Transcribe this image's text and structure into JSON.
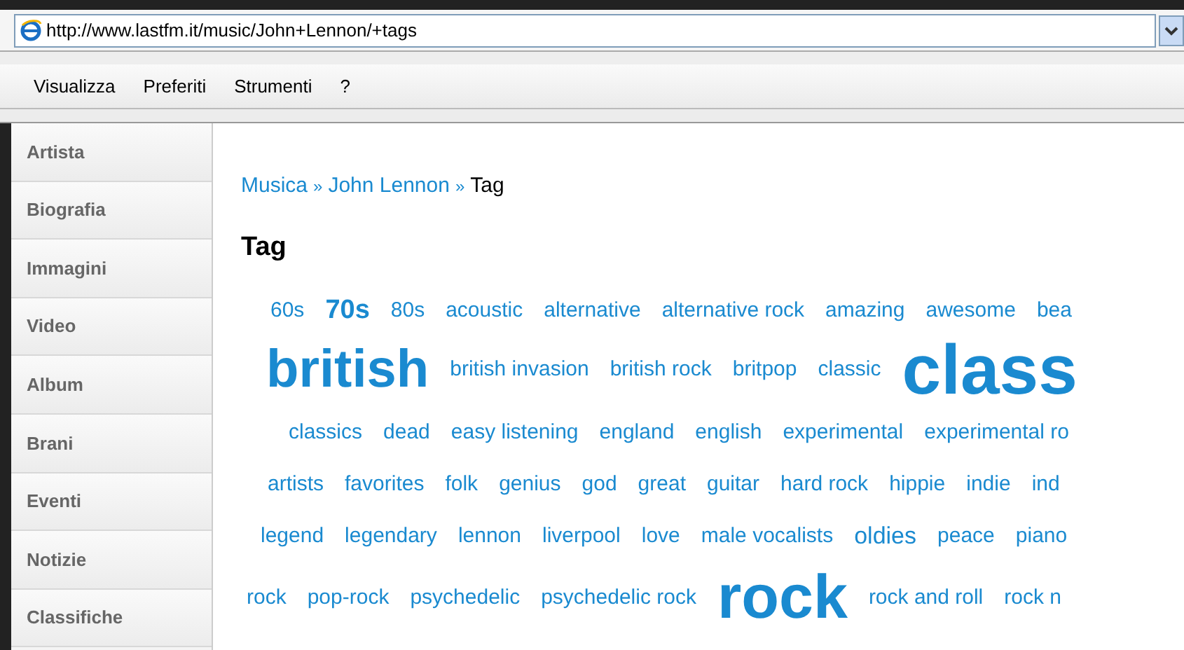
{
  "address_bar": {
    "url": "http://www.lastfm.it/music/John+Lennon/+tags"
  },
  "menu_bar": [
    "Visualizza",
    "Preferiti",
    "Strumenti",
    "?"
  ],
  "sidebar": {
    "items": [
      "Artista",
      "Biografia",
      "Immagini",
      "Video",
      "Album",
      "Brani",
      "Eventi",
      "Notizie",
      "Classifiche"
    ]
  },
  "breadcrumb": {
    "links": [
      "Musica",
      "John Lennon"
    ],
    "current": "Tag",
    "separator": "»"
  },
  "heading": "Tag",
  "tag_cloud": [
    [
      {
        "text": "60s",
        "kind": "normal"
      },
      {
        "text": "70s",
        "kind": "medium"
      },
      {
        "text": "80s",
        "kind": "normal"
      },
      {
        "text": "acoustic",
        "kind": "normal"
      },
      {
        "text": "alternative",
        "kind": "normal"
      },
      {
        "text": "alternative rock",
        "kind": "normal"
      },
      {
        "text": "amazing",
        "kind": "normal"
      },
      {
        "text": "awesome",
        "kind": "normal"
      },
      {
        "text": "bea",
        "kind": "normal"
      }
    ],
    [
      {
        "text": "british",
        "kind": "large"
      },
      {
        "text": "british invasion",
        "kind": "normal"
      },
      {
        "text": "british rock",
        "kind": "normal"
      },
      {
        "text": "britpop",
        "kind": "normal"
      },
      {
        "text": "classic",
        "kind": "normal"
      },
      {
        "text": "class",
        "kind": "huge"
      }
    ],
    [
      {
        "text": "classics",
        "kind": "normal"
      },
      {
        "text": "dead",
        "kind": "normal"
      },
      {
        "text": "easy listening",
        "kind": "normal"
      },
      {
        "text": "england",
        "kind": "normal"
      },
      {
        "text": "english",
        "kind": "normal"
      },
      {
        "text": "experimental",
        "kind": "normal"
      },
      {
        "text": "experimental ro",
        "kind": "normal"
      }
    ],
    [
      {
        "text": "artists",
        "kind": "normal"
      },
      {
        "text": "favorites",
        "kind": "normal"
      },
      {
        "text": "folk",
        "kind": "normal"
      },
      {
        "text": "genius",
        "kind": "normal"
      },
      {
        "text": "god",
        "kind": "normal"
      },
      {
        "text": "great",
        "kind": "normal"
      },
      {
        "text": "guitar",
        "kind": "normal"
      },
      {
        "text": "hard rock",
        "kind": "normal"
      },
      {
        "text": "hippie",
        "kind": "normal"
      },
      {
        "text": "indie",
        "kind": "normal"
      },
      {
        "text": "ind",
        "kind": "normal"
      }
    ],
    [
      {
        "text": "legend",
        "kind": "normal"
      },
      {
        "text": "legendary",
        "kind": "normal"
      },
      {
        "text": "lennon",
        "kind": "normal"
      },
      {
        "text": "liverpool",
        "kind": "normal"
      },
      {
        "text": "love",
        "kind": "normal"
      },
      {
        "text": "male vocalists",
        "kind": "normal"
      },
      {
        "text": "oldies",
        "kind": "small-up"
      },
      {
        "text": "peace",
        "kind": "normal"
      },
      {
        "text": "piano",
        "kind": "normal"
      }
    ],
    [
      {
        "text": "rock",
        "kind": "normal"
      },
      {
        "text": "pop-rock",
        "kind": "normal"
      },
      {
        "text": "psychedelic",
        "kind": "normal"
      },
      {
        "text": "psychedelic rock",
        "kind": "normal"
      },
      {
        "text": "rock",
        "kind": "large-rock"
      },
      {
        "text": "rock and roll",
        "kind": "normal"
      },
      {
        "text": "rock n",
        "kind": "normal"
      }
    ]
  ]
}
